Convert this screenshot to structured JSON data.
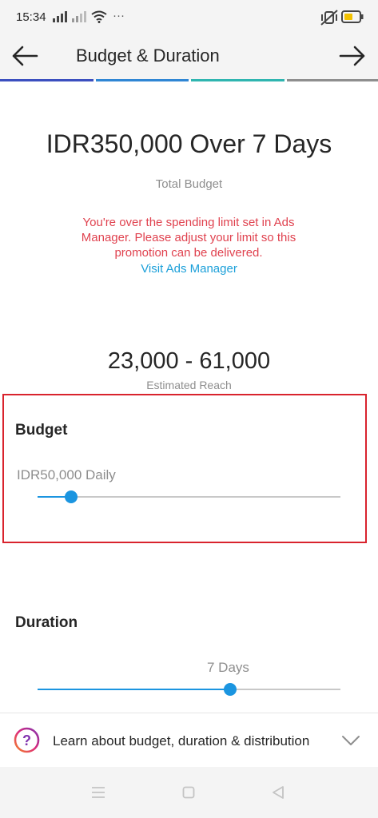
{
  "status_bar": {
    "time": "15:34",
    "more_dots": "···",
    "icons": [
      "signal-icon",
      "signal-no-sim-icon",
      "wifi-icon",
      "more-icon",
      "vibrate-icon",
      "battery-icon"
    ]
  },
  "header": {
    "title": "Budget & Duration",
    "back_icon": "arrow-left-icon",
    "next_icon": "arrow-right-icon",
    "progress_colors": [
      "#3b4fbf",
      "#2f86d4",
      "#2fb5b0",
      "#8e8e8e"
    ]
  },
  "summary": {
    "total": "IDR350,000 Over 7 Days",
    "total_label": "Total Budget",
    "warning": "You're over the spending limit set in Ads Manager. Please adjust your limit so this promotion can be delivered.",
    "warning_color": "#e0424f",
    "link": "Visit Ads Manager",
    "link_color": "#1a9fd9"
  },
  "reach": {
    "value": "23,000 - 61,000",
    "label": "Estimated Reach"
  },
  "budget": {
    "heading": "Budget",
    "value_label": "IDR50,000 Daily",
    "slider_fraction": 0.11,
    "highlight_color": "#d9232d"
  },
  "duration": {
    "heading": "Duration",
    "value_label": "7 Days",
    "slider_fraction": 0.635
  },
  "learn": {
    "text": "Learn about budget, duration & distribution",
    "help_icon": "question-circle-icon",
    "expand_icon": "chevron-down-icon"
  },
  "nav": {
    "icons": [
      "menu-icon",
      "home-square-icon",
      "back-triangle-icon"
    ]
  }
}
